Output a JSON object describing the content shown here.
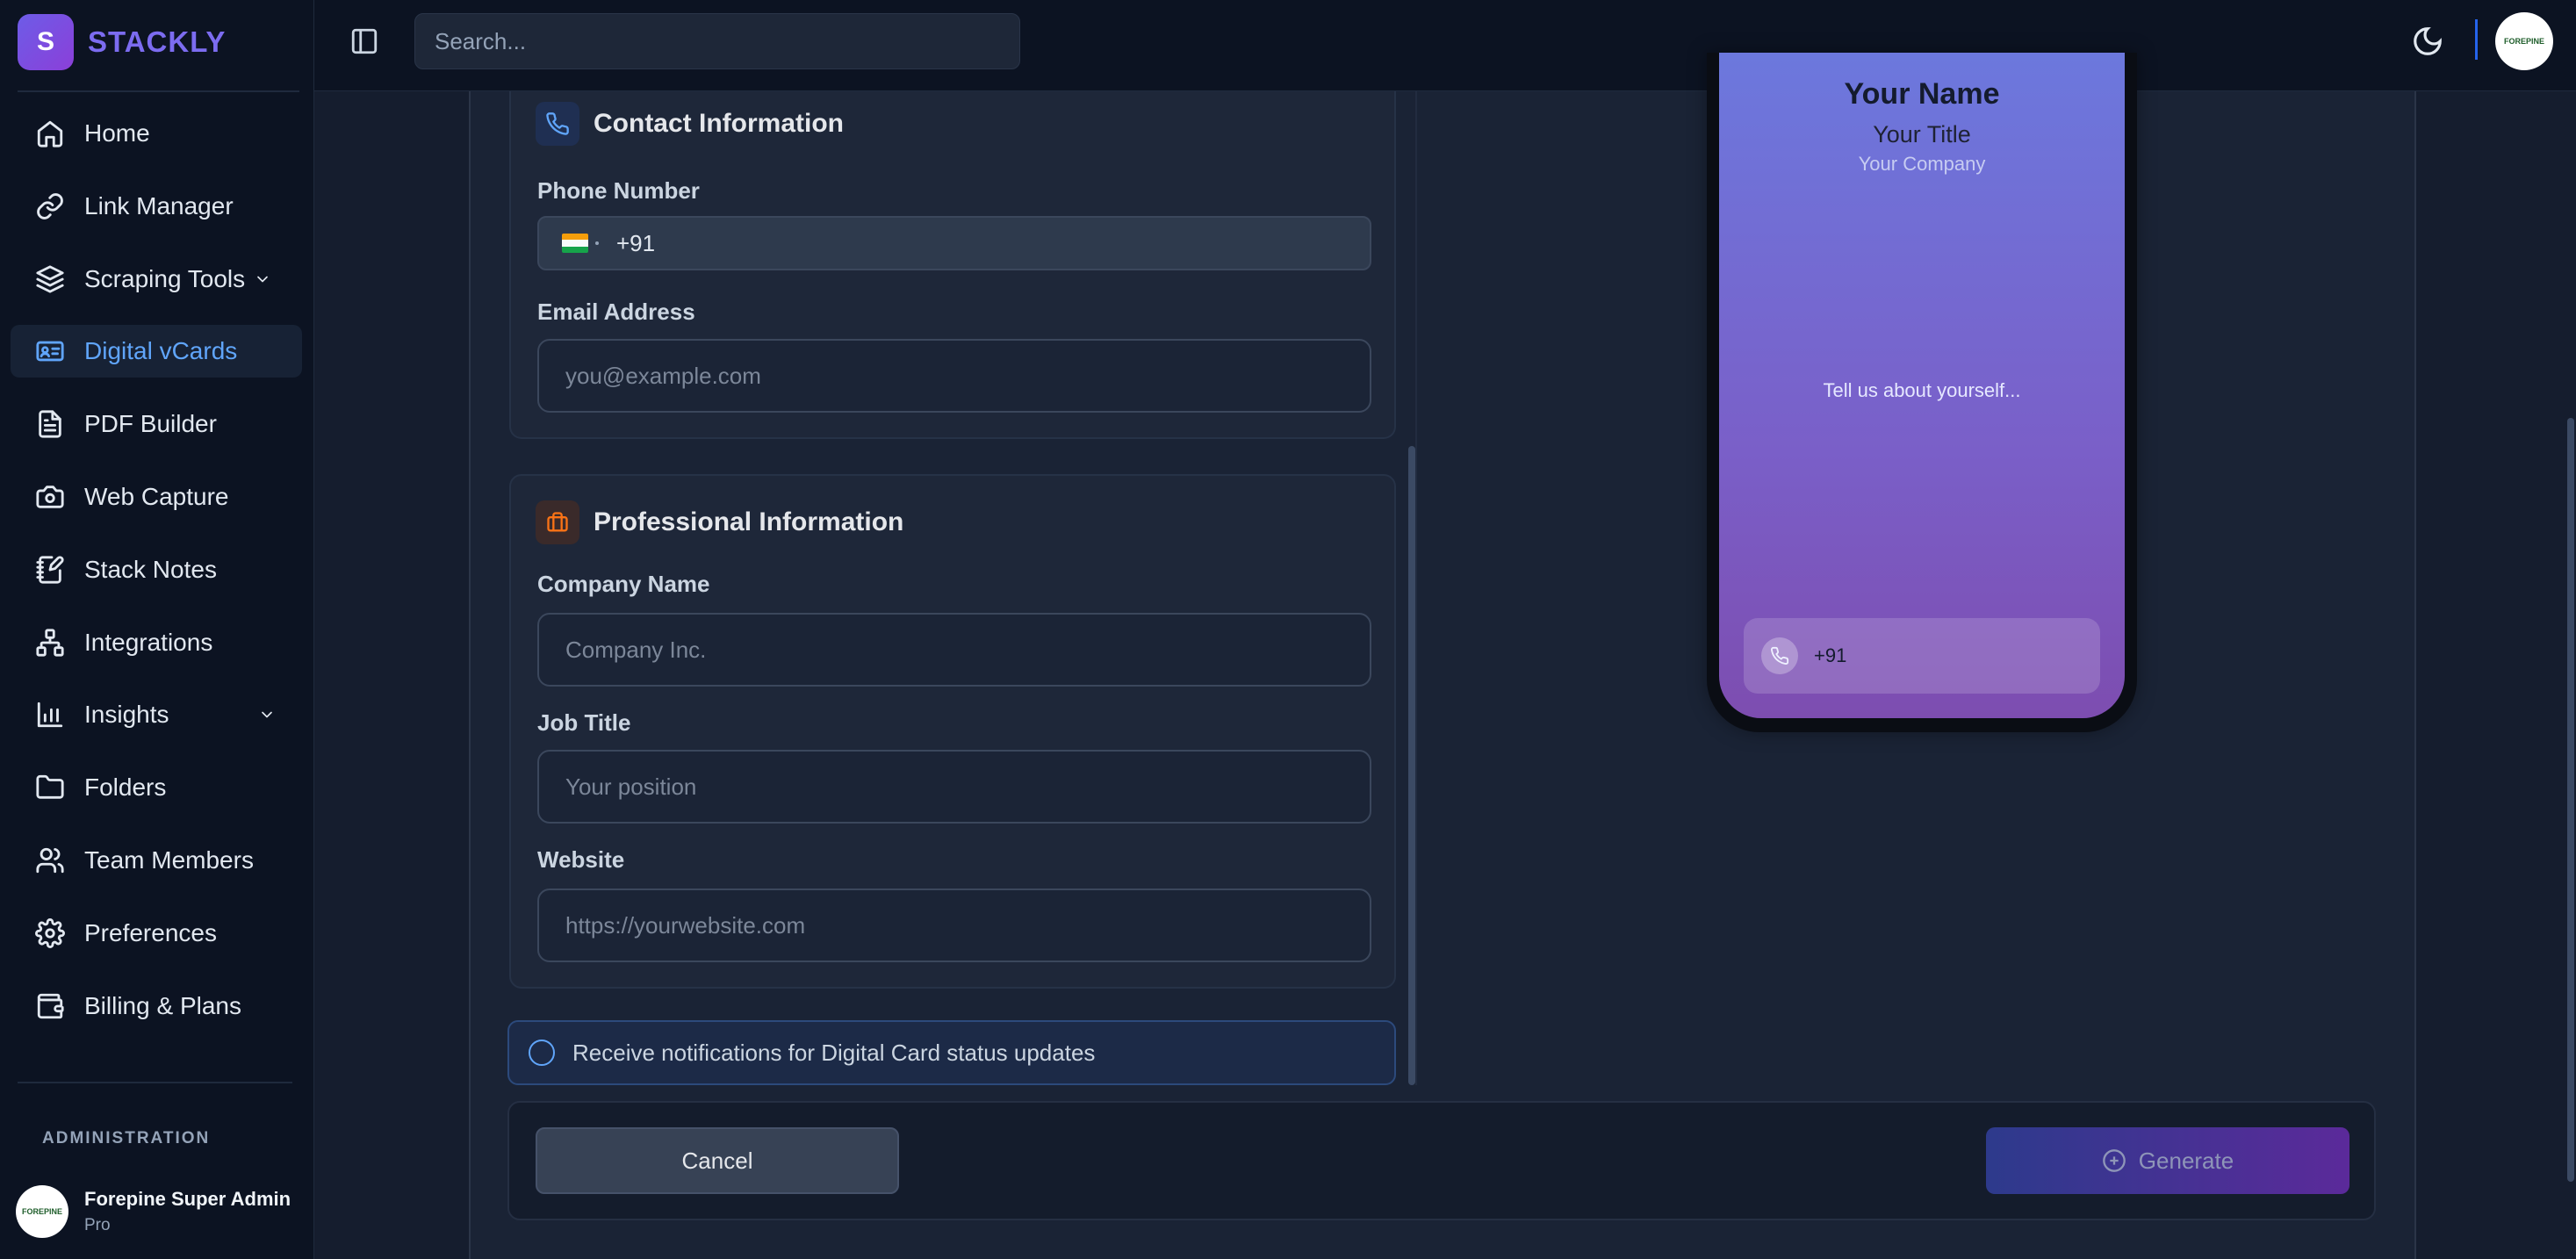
{
  "brand": {
    "logo_letter": "S",
    "name": "STACKLY"
  },
  "search": {
    "placeholder": "Search..."
  },
  "sidebar": {
    "items": [
      {
        "label": "Home",
        "icon": "home-icon"
      },
      {
        "label": "Link Manager",
        "icon": "link-icon"
      },
      {
        "label": "Scraping Tools",
        "icon": "layers-icon"
      },
      {
        "label": "Digital vCards",
        "icon": "id-card-icon",
        "active": true
      },
      {
        "label": "PDF Builder",
        "icon": "file-text-icon"
      },
      {
        "label": "Web Capture",
        "icon": "camera-icon"
      },
      {
        "label": "Stack Notes",
        "icon": "notebook-pen-icon"
      },
      {
        "label": "Integrations",
        "icon": "network-icon"
      },
      {
        "label": "Insights",
        "icon": "bar-chart-icon"
      },
      {
        "label": "Folders",
        "icon": "folder-icon"
      },
      {
        "label": "Team Members",
        "icon": "users-icon"
      },
      {
        "label": "Preferences",
        "icon": "settings-icon"
      },
      {
        "label": "Billing & Plans",
        "icon": "wallet-icon"
      }
    ],
    "admin_label": "ADMINISTRATION",
    "user": {
      "name": "Forepine Super Admin",
      "plan": "Pro",
      "avatar_text": "FOREPINE"
    }
  },
  "topbar": {
    "avatar_text": "FOREPINE"
  },
  "contact": {
    "title": "Contact Information",
    "phone_label": "Phone Number",
    "phone_code": "+91",
    "email_label": "Email Address",
    "email_placeholder": "you@example.com"
  },
  "professional": {
    "title": "Professional Information",
    "company_label": "Company Name",
    "company_placeholder": "Company Inc.",
    "job_label": "Job Title",
    "job_placeholder": "Your position",
    "website_label": "Website",
    "website_placeholder": "https://yourwebsite.com"
  },
  "notify": {
    "label": "Receive notifications for Digital Card status updates"
  },
  "actions": {
    "cancel": "Cancel",
    "generate": "Generate"
  },
  "preview": {
    "name": "Your Name",
    "title": "Your Title",
    "company": "Your Company",
    "about": "Tell us about yourself...",
    "phone": "+91"
  },
  "colors": {
    "accent": "#60a5fa",
    "brand": "#7c6cf0",
    "sidebar_bg": "#0c1322",
    "main_bg": "#1a2335",
    "preview_gradient_top": "#6c78dd",
    "preview_gradient_bottom": "#7d4db0"
  }
}
